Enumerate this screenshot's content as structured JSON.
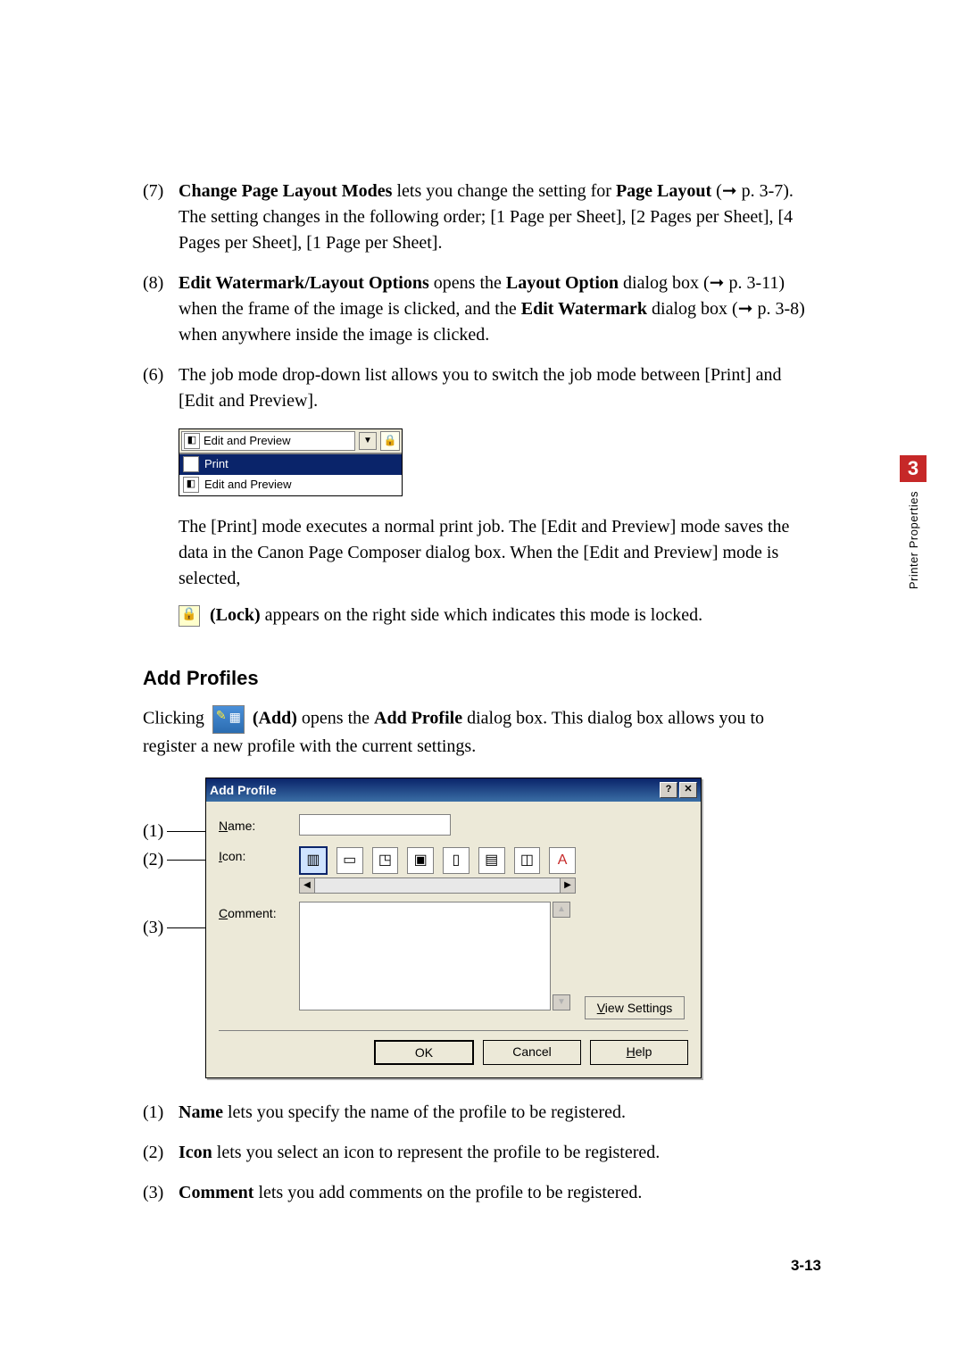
{
  "chapter": {
    "number": "3",
    "title": "Printer Properties",
    "page_number": "3-13"
  },
  "paragraphs": {
    "p7_num": "(7)",
    "p7_bold": "Change Page Layout Modes",
    "p7_mid1": " lets you change the setting for ",
    "p7_bold2": "Page Layout",
    "p7_mid2": " (➞ p. 3-7). The setting changes in the following order; [1 Page per Sheet], [2 Pages per Sheet], [4 Pages per Sheet], [1 Page per Sheet].",
    "p8_num": "(8)",
    "p8_bold": "Edit Watermark/Layout Options",
    "p8_mid1": " opens the ",
    "p8_bold2": "Layout Option",
    "p8_mid2": " dialog box (➞ p. 3-11) when the frame of the image is clicked, and the ",
    "p8_bold3": "Edit Watermark",
    "p8_mid3": " dialog box (➞ p. 3-8) when anywhere inside the image is clicked.",
    "p6_num": "(6)",
    "p6_text": "The job mode drop-down list allows you to switch the job mode between [Print] and [Edit and Preview].",
    "explain_modes": "The [Print] mode executes a normal print job. The [Edit and Preview] mode saves the data in the Canon Page Composer dialog box. When the [Edit and Preview] mode is selected,",
    "lock_bold": "(Lock)",
    "lock_rest": " appears on the right side which indicates this mode is locked."
  },
  "dropdown": {
    "selected": "Edit and Preview",
    "items": [
      {
        "label": "Print"
      },
      {
        "label": "Edit and Preview"
      }
    ]
  },
  "add_profiles": {
    "heading": "Add Profiles",
    "intro_pre": "Clicking ",
    "intro_bold": " (Add)",
    "intro_mid": " opens the ",
    "intro_bold2": "Add Profile",
    "intro_post": " dialog box. This dialog box allows you to register a new profile with the current settings."
  },
  "dialog": {
    "title": "Add Profile",
    "help_char": "?",
    "close_char": "✕",
    "name_label_pre": "N",
    "name_label_post": "ame:",
    "icon_label_pre": "I",
    "icon_label_post": "con:",
    "comment_label_pre": "C",
    "comment_label_post": "omment:",
    "view_pre": "V",
    "view_post": "iew Settings",
    "ok": "OK",
    "cancel": "Cancel",
    "help_pre": "H",
    "help_post": "elp"
  },
  "callouts": {
    "c1": "(1)",
    "c2": "(2)",
    "c3": "(3)"
  },
  "descriptions": {
    "d1_num": "(1)",
    "d1_bold": "Name",
    "d1_rest": " lets you specify the name of the profile to be registered.",
    "d2_num": "(2)",
    "d2_bold": "Icon",
    "d2_rest": " lets you select an icon to represent the profile to be registered.",
    "d3_num": "(3)",
    "d3_bold": "Comment",
    "d3_rest": " lets you add comments on the profile to be registered."
  }
}
